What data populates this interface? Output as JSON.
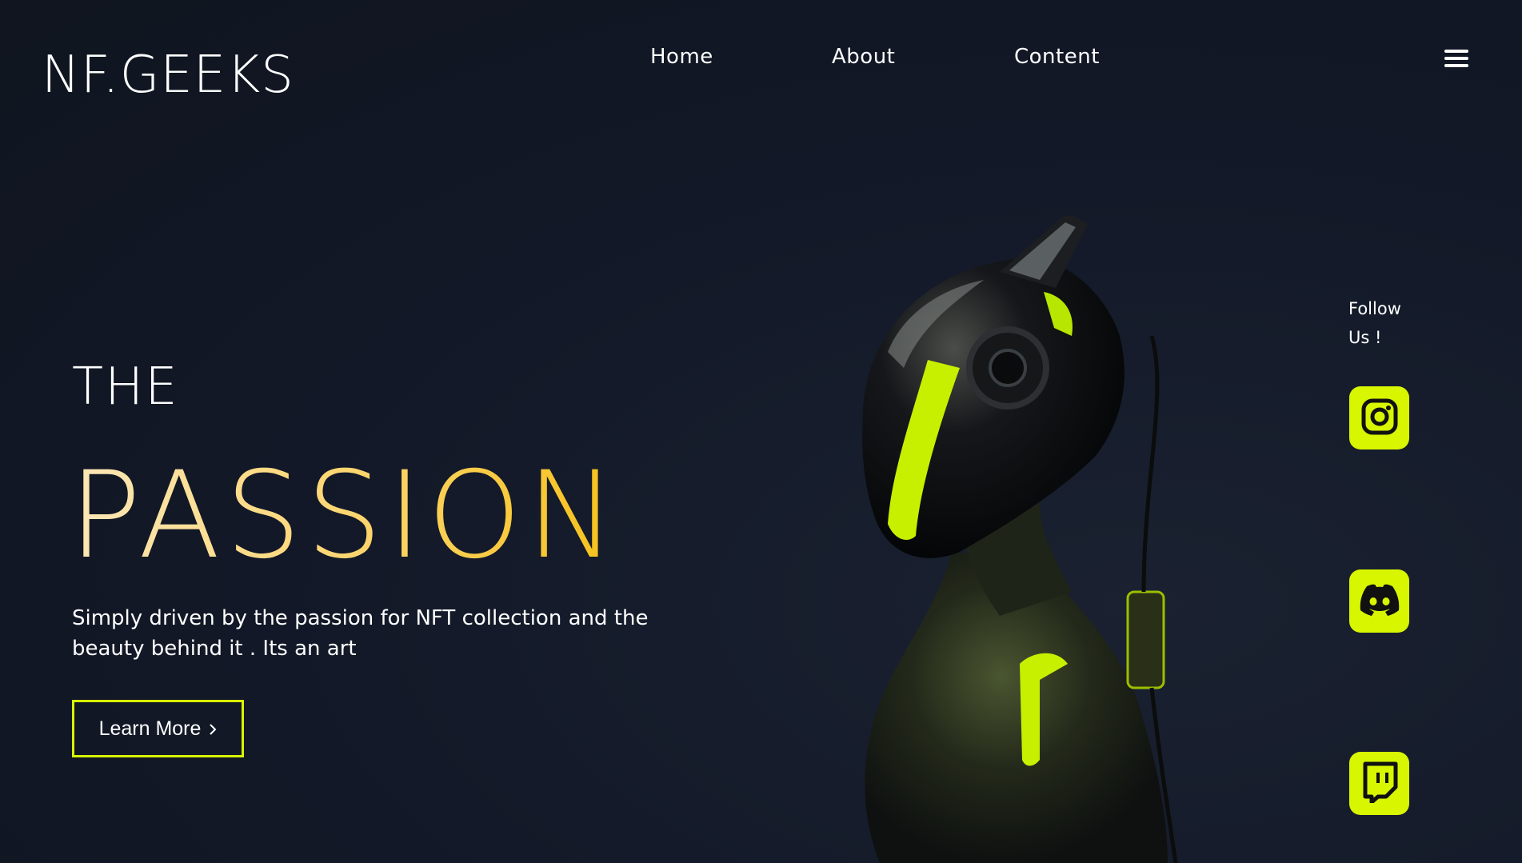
{
  "brand": {
    "logo": "NF.GEEKS"
  },
  "nav": {
    "items": [
      "Home",
      "About",
      "Content"
    ]
  },
  "hero": {
    "line1": "THE",
    "line2": "PASSION",
    "description": "Simply driven by the passion for NFT collection and the beauty behind it . Its an art",
    "cta_label": "Learn More",
    "cta_icon": "chevron-right-icon"
  },
  "social": {
    "title": "Follow Us !",
    "items": [
      {
        "name": "instagram",
        "icon": "instagram-icon"
      },
      {
        "name": "discord",
        "icon": "discord-icon"
      },
      {
        "name": "twitch",
        "icon": "twitch-icon"
      }
    ]
  },
  "colors": {
    "background": "#121827",
    "accent": "#d7f600",
    "gradient_start": "#fbe7b8",
    "gradient_end": "#f6c11a",
    "text": "#ffffff"
  }
}
